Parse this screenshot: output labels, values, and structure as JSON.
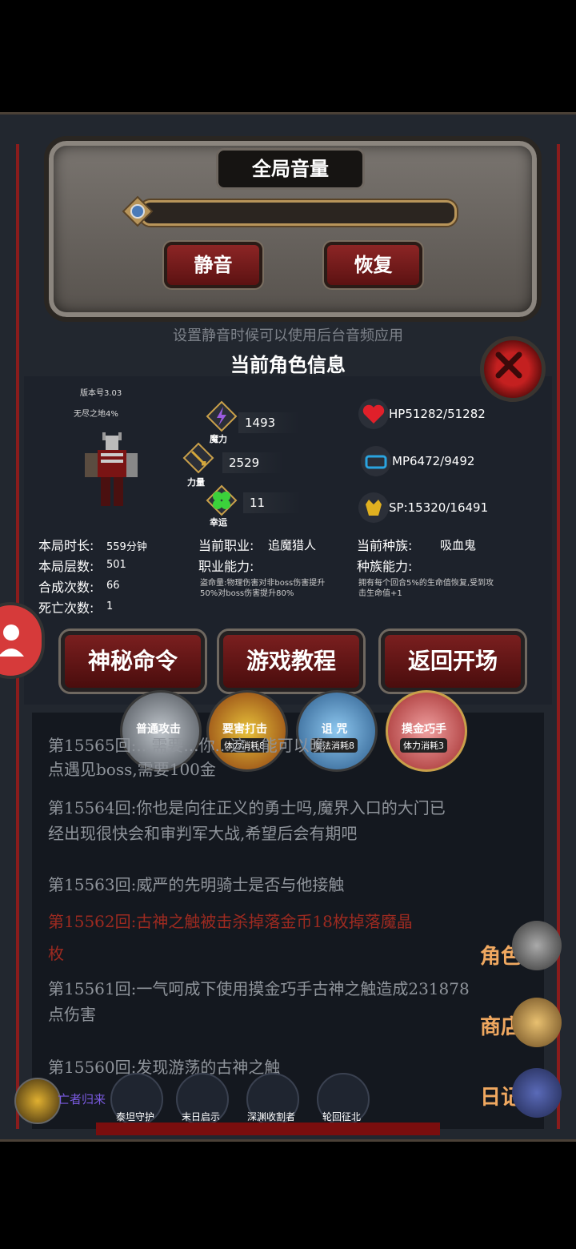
{
  "volume": {
    "title": "全局音量",
    "mute_label": "静音",
    "restore_label": "恢复",
    "hint": "设置静音时候可以使用后台音频应用"
  },
  "info": {
    "title": "当前角色信息",
    "version": "版本号3.03",
    "zone": "无尽之地4%",
    "stats": {
      "magic": {
        "label": "魔力",
        "value": "1493"
      },
      "strength": {
        "label": "力量",
        "value": "2529"
      },
      "luck": {
        "label": "幸运",
        "value": "11"
      }
    },
    "hp": {
      "label": "HP",
      "value": "51282/51282"
    },
    "mp": {
      "label": "MP",
      "value": "6472/9492"
    },
    "sp": {
      "label": "SP:",
      "value": "15320/16491"
    },
    "left_rows": [
      {
        "label": "本局时长:",
        "value": "559分钟"
      },
      {
        "label": "本局层数:",
        "value": "501"
      },
      {
        "label": "合成次数:",
        "value": "66"
      },
      {
        "label": "死亡次数:",
        "value": "1"
      }
    ],
    "job_label": "当前职业:",
    "job_value": "追魔猎人",
    "job_ability_label": "职业能力:",
    "job_ability_text": "盗命量:物理伤害对非boss伤害提升50%对boss伤害提升80%",
    "race_label": "当前种族:",
    "race_value": "吸血鬼",
    "race_ability_label": "种族能力:",
    "race_ability_text": "拥有每个回合5%的生命值恢复,受到攻击生命值+1"
  },
  "menu": {
    "secret": "神秘命令",
    "tutorial": "游戏教程",
    "back": "返回开场"
  },
  "skills": [
    {
      "name": "普通攻击",
      "cost": ""
    },
    {
      "name": "要害打击",
      "cost": "体力消耗8"
    },
    {
      "name": "诅 咒",
      "cost": "魔法消耗8"
    },
    {
      "name": "摸金巧手",
      "cost": "体力消耗3"
    }
  ],
  "log": [
    {
      "text": "第15565回:...需要...你...这...能可以晚",
      "red": false
    },
    {
      "text": "点遇见boss,需要100金",
      "red": false
    },
    {
      "text": "第15564回:你也是向往正义的勇士吗,魔界入口的大门已",
      "red": false
    },
    {
      "text": "经出现很快会和审判军大战,希望后会有期吧",
      "red": false
    },
    {
      "text": "第15563回:威严的先明骑士是否与他接触",
      "red": false
    },
    {
      "text": "第15562回:古神之触被击杀掉落金币18枚掉落魔晶",
      "red": true
    },
    {
      "text": "枚",
      "red": true
    },
    {
      "text": "第15561回:一气呵成下使用摸金巧手古神之触造成231878",
      "red": false
    },
    {
      "text": "点伤害",
      "red": false
    },
    {
      "text": "第15560回:发现游荡的古神之触",
      "red": false
    }
  ],
  "side": {
    "role": "角色",
    "shop": "商店",
    "diary": "日记"
  },
  "bottom": {
    "guild": "亡者归来",
    "items": [
      "泰坦守护",
      "末日启示",
      "深渊收割者",
      "轮回征北"
    ]
  },
  "colors": {
    "accent_red": "#8c2525",
    "gold": "#b8955a",
    "orange": "#f0a860"
  }
}
